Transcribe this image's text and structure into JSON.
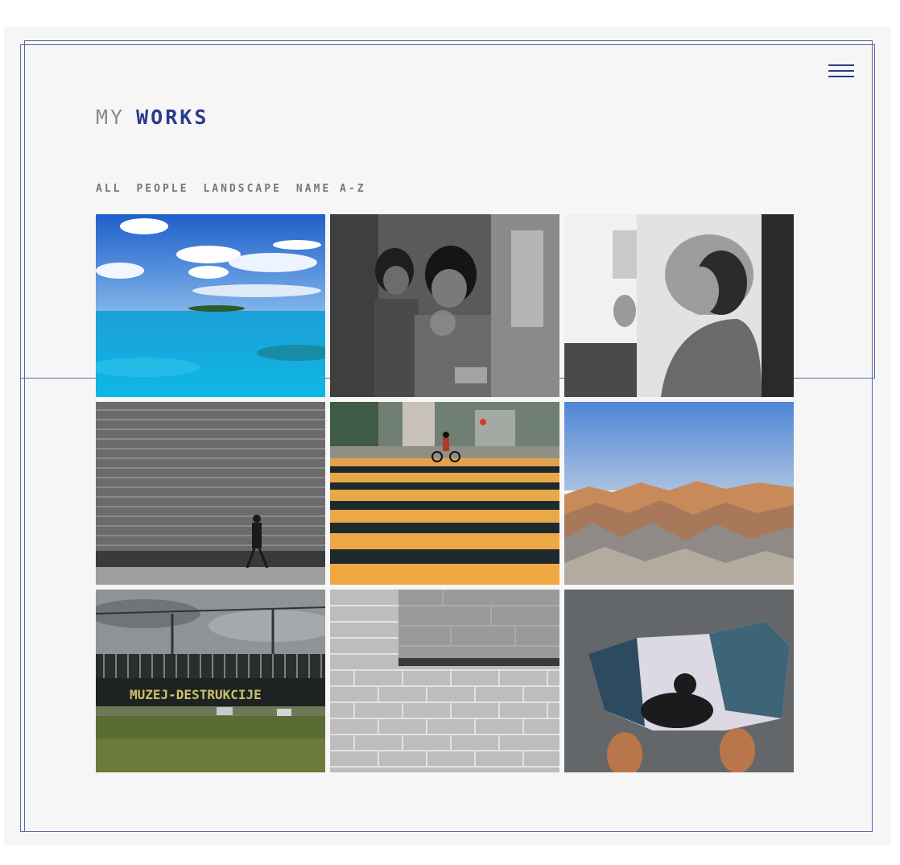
{
  "header": {
    "title_light": "MY",
    "title_bold": "WORKS",
    "menu_icon": "hamburger-menu-icon"
  },
  "filters": [
    {
      "label": "ALL"
    },
    {
      "label": "PEOPLE"
    },
    {
      "label": "LANDSCAPE"
    },
    {
      "label": "NAME A-Z"
    }
  ],
  "colors": {
    "accent": "#2b3a8a",
    "muted": "#8a8a8a",
    "background": "#f6f6f6"
  },
  "gallery": [
    {
      "subject": "tropical-island-sea"
    },
    {
      "subject": "tribal-women-bw"
    },
    {
      "subject": "woman-smoking-bw"
    },
    {
      "subject": "pedestrian-shutter-wall"
    },
    {
      "subject": "cyclist-crosswalk"
    },
    {
      "subject": "badlands-canyon"
    },
    {
      "subject": "bridge-graffiti"
    },
    {
      "subject": "brick-wall-corner"
    },
    {
      "subject": "puddle-reflection-shoes"
    }
  ],
  "texts": {
    "graffiti": "MUZEJ-DESTRUKCIJE"
  }
}
